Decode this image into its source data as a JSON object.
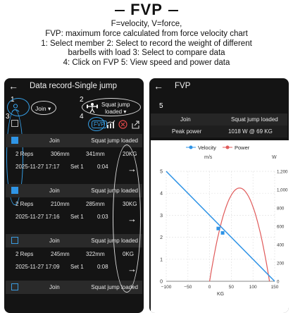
{
  "header": {
    "title": "FVP",
    "lines": [
      "F=velocity, V=force,",
      "FVP: maximum force calculated from force velocity chart",
      "1: Select member 2: Select to record the weight of different",
      "barbells with load 3: Select to compare data",
      "4: Click on FVP 5: View speed and power data"
    ]
  },
  "left_screen": {
    "back_icon": "arrow-left-icon",
    "title": "Data record-Single jump",
    "member_select": "Join",
    "load_select_line1": "Squat jump",
    "load_select_line2": "loaded",
    "fvp_button": "FVP",
    "annotations": [
      "1",
      "2",
      "3",
      "4"
    ],
    "records": [
      {
        "checked": true,
        "member": "Join",
        "load_type": "Squat jump loaded",
        "reps": "2 Reps",
        "height1": "306mm",
        "height2": "341mm",
        "weight": "20KG",
        "date": "2025-11-27 17:17",
        "set": "Set 1",
        "time": "0:04"
      },
      {
        "checked": true,
        "member": "Join",
        "load_type": "Squat jump loaded",
        "reps": "2 Reps",
        "height1": "210mm",
        "height2": "285mm",
        "weight": "30KG",
        "date": "2025-11-27 17:16",
        "set": "Set 1",
        "time": "0:03"
      },
      {
        "checked": false,
        "member": "Join",
        "load_type": "Squat jump loaded",
        "reps": "2 Reps",
        "height1": "245mm",
        "height2": "322mm",
        "weight": "0KG",
        "date": "2025-11-27 17:09",
        "set": "Set 1",
        "time": "0:08"
      },
      {
        "checked": false,
        "member": "Join",
        "load_type": "Squat jump loaded"
      }
    ]
  },
  "right_screen": {
    "back_icon": "arrow-left-icon",
    "title": "FVP",
    "annotation": "5",
    "member": "Join",
    "load_type": "Squat jump loaded",
    "peak_label": "Peak power",
    "peak_value": "1018 W @ 69 KG"
  },
  "chart_data": {
    "type": "line",
    "legend": [
      "Velocity",
      "Power"
    ],
    "legend_units": [
      "m/s",
      "W"
    ],
    "colors": {
      "velocity": "#2e93e6",
      "power": "#e05a5a"
    },
    "xlabel": "KG",
    "x_ticks": [
      -100,
      -50,
      0,
      50,
      100,
      150
    ],
    "y_left_ticks": [
      0,
      1,
      2,
      3,
      4,
      5
    ],
    "y_right_ticks": [
      0,
      200,
      400,
      600,
      800,
      1000,
      1200
    ],
    "velocity_series": {
      "x": [
        -100,
        150
      ],
      "y": [
        5,
        0
      ]
    },
    "power_points": {
      "x": [
        20,
        30
      ],
      "y": [
        2.4,
        2.2
      ]
    },
    "power_curve_peak": {
      "x": 69,
      "y": 1018
    }
  }
}
